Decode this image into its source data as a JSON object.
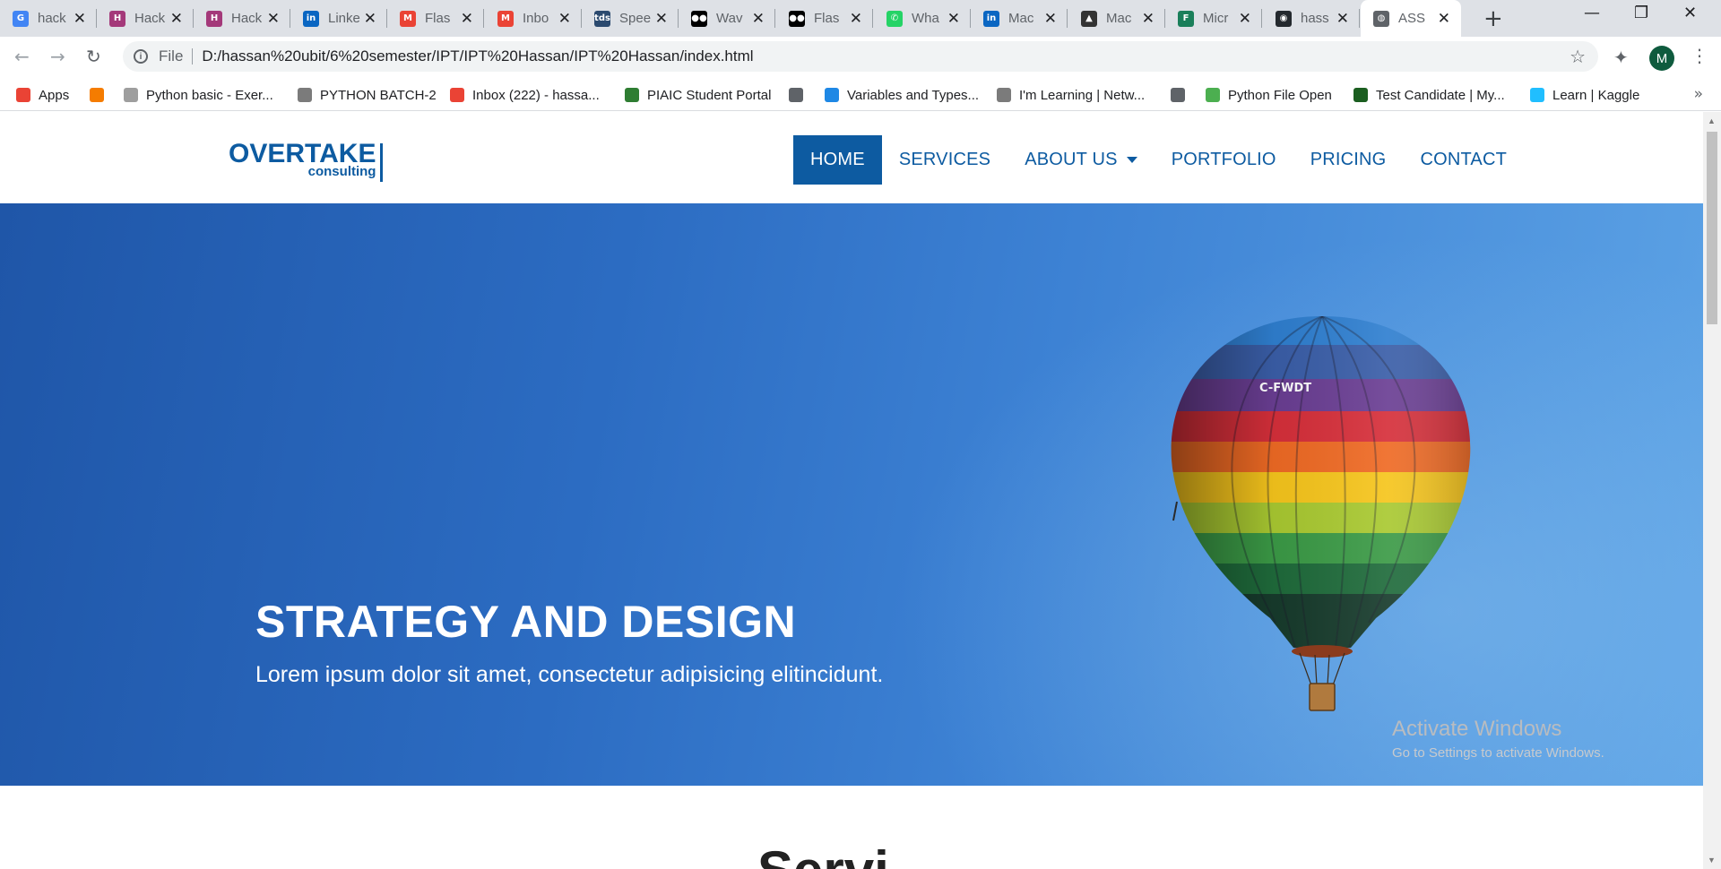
{
  "browser": {
    "tabs": [
      {
        "title": "hack",
        "color": "#4285f4",
        "glyph": "G",
        "active": false
      },
      {
        "title": "Hack",
        "color": "#a4397a",
        "glyph": "H",
        "active": false
      },
      {
        "title": "Hack",
        "color": "#a4397a",
        "glyph": "H",
        "active": false
      },
      {
        "title": "Linke",
        "color": "#0a66c2",
        "glyph": "in",
        "active": false
      },
      {
        "title": "Flas",
        "color": "#ea4335",
        "glyph": "M",
        "active": false
      },
      {
        "title": "Inbo",
        "color": "#ea4335",
        "glyph": "M",
        "active": false
      },
      {
        "title": "Spee",
        "color": "#2b4a6f",
        "glyph": "tds",
        "active": false
      },
      {
        "title": "Wav",
        "color": "#000000",
        "glyph": "●●",
        "active": false
      },
      {
        "title": "Flas",
        "color": "#000000",
        "glyph": "●●",
        "active": false
      },
      {
        "title": "Wha",
        "color": "#25d366",
        "glyph": "✆",
        "active": false
      },
      {
        "title": "Mac",
        "color": "#0a66c2",
        "glyph": "in",
        "active": false
      },
      {
        "title": "Mac",
        "color": "#333333",
        "glyph": "▲",
        "active": false
      },
      {
        "title": "Micr",
        "color": "#1a7f5a",
        "glyph": "F",
        "active": false
      },
      {
        "title": "hass",
        "color": "#24292e",
        "glyph": "◉",
        "active": false
      },
      {
        "title": "ASS",
        "color": "#5f6368",
        "glyph": "◍",
        "active": true
      }
    ],
    "new_tab_label": "+",
    "file_label": "File",
    "url": "D:/hassan%20ubit/6%20semester/IPT/IPT%20Hassan/IPT%20Hassan/index.html",
    "profile_initial": "M",
    "bookmarks": [
      {
        "label": "Apps",
        "icon": "apps-icon",
        "color": "#ea4335"
      },
      {
        "label": "",
        "icon": "loader-icon",
        "color": "#f57c00"
      },
      {
        "label": "Python basic - Exer...",
        "icon": "w3r-icon",
        "color": "#9e9e9e"
      },
      {
        "label": "PYTHON BATCH-2",
        "icon": "cisco-icon",
        "color": "#7b7b7b"
      },
      {
        "label": "Inbox (222) - hassa...",
        "icon": "gmail-icon",
        "color": "#ea4335"
      },
      {
        "label": "PIAIC Student Portal",
        "icon": "piaic-icon",
        "color": "#2e7d32"
      },
      {
        "label": "",
        "icon": "globe-icon",
        "color": "#5f6368"
      },
      {
        "label": "Variables and Types...",
        "icon": "shield-icon",
        "color": "#1e88e5"
      },
      {
        "label": "I'm Learning | Netw...",
        "icon": "cisco-icon",
        "color": "#7b7b7b"
      },
      {
        "label": "",
        "icon": "globe-icon",
        "color": "#5f6368"
      },
      {
        "label": "Python File Open",
        "icon": "w3-icon",
        "color": "#4caf50"
      },
      {
        "label": "Test Candidate | My...",
        "icon": "hackerrank-icon",
        "color": "#1b5e20"
      },
      {
        "label": "Learn | Kaggle",
        "icon": "kaggle-icon",
        "color": "#20beff"
      }
    ],
    "bookmarks_more": "»"
  },
  "site": {
    "logo_main": "OVERTAKE",
    "logo_sub": "consulting",
    "nav": [
      {
        "label": "HOME",
        "active": true,
        "dropdown": false
      },
      {
        "label": "SERVICES",
        "active": false,
        "dropdown": false
      },
      {
        "label": "ABOUT US",
        "active": false,
        "dropdown": true
      },
      {
        "label": "PORTFOLIO",
        "active": false,
        "dropdown": false
      },
      {
        "label": "PRICING",
        "active": false,
        "dropdown": false
      },
      {
        "label": "CONTACT",
        "active": false,
        "dropdown": false
      }
    ],
    "hero": {
      "title": "STRATEGY AND DESIGN",
      "subtitle": "Lorem ipsum dolor sit amet, consectetur adipisicing elitincidunt.",
      "balloon_registration": "C-FWDT"
    },
    "next_section_title_partial": "Servi"
  },
  "watermark": {
    "line1": "Activate Windows",
    "line2": "Go to Settings to activate Windows."
  },
  "colors": {
    "brand": "#0d5ba1",
    "hero_dark": "#1f56a8",
    "hero_light": "#5ea4e6"
  }
}
